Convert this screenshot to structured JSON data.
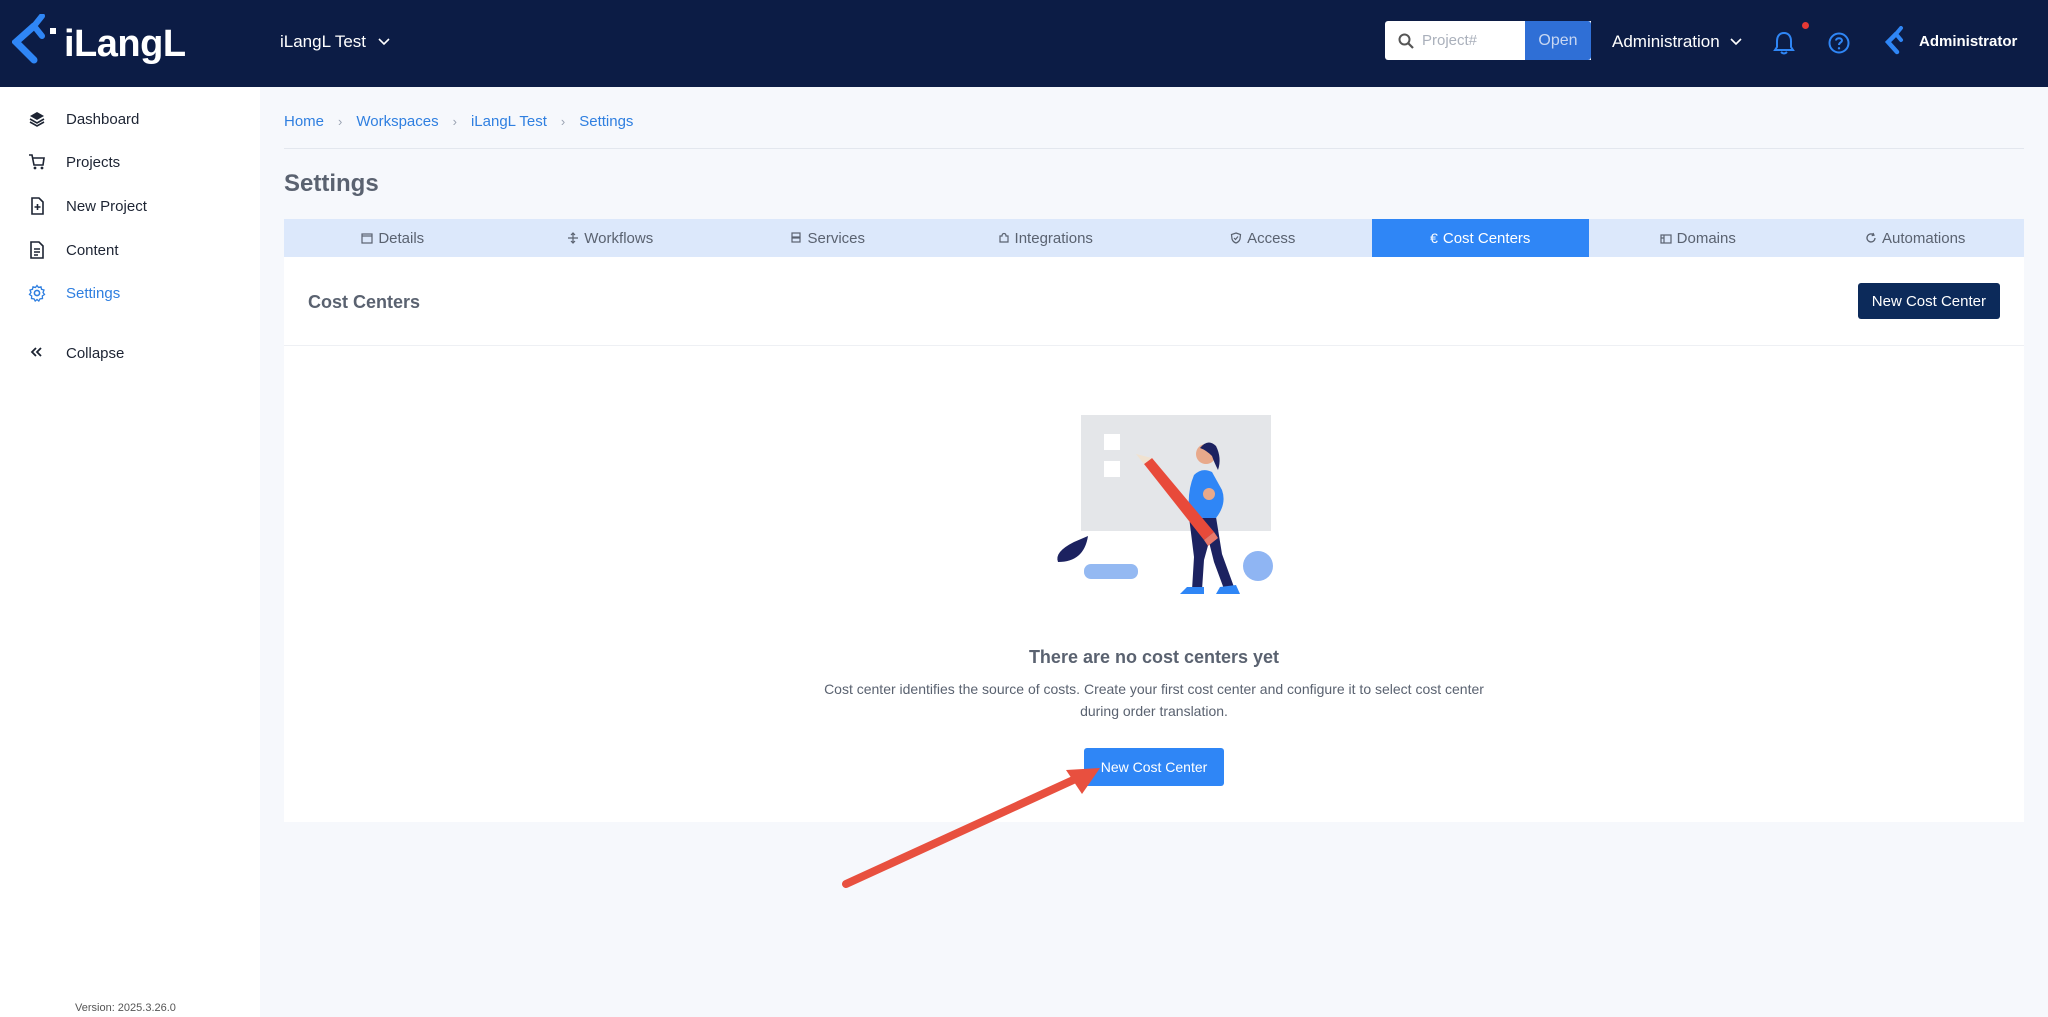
{
  "brand": {
    "logo_text": "iLangL"
  },
  "header": {
    "workspace": "iLangL Test",
    "search_placeholder": "Project#",
    "open_label": "Open",
    "admin_menu": "Administration",
    "user_name": "Administrator"
  },
  "sidebar": {
    "items": [
      {
        "label": "Dashboard",
        "icon": "layers-icon"
      },
      {
        "label": "Projects",
        "icon": "cart-icon"
      },
      {
        "label": "New Project",
        "icon": "file-plus-icon"
      },
      {
        "label": "Content",
        "icon": "documents-icon"
      },
      {
        "label": "Settings",
        "icon": "gear-icon",
        "active": true
      },
      {
        "label": "Collapse",
        "icon": "double-chevron-left-icon"
      }
    ],
    "version": "Version: 2025.3.26.0"
  },
  "breadcrumb": [
    "Home",
    "Workspaces",
    "iLangL Test",
    "Settings"
  ],
  "page_title": "Settings",
  "tabs": [
    {
      "label": "Details",
      "icon": "details-icon"
    },
    {
      "label": "Workflows",
      "icon": "workflow-icon"
    },
    {
      "label": "Services",
      "icon": "server-icon"
    },
    {
      "label": "Integrations",
      "icon": "puzzle-icon"
    },
    {
      "label": "Access",
      "icon": "shield-icon"
    },
    {
      "label": "Cost Centers",
      "icon": "euro-icon",
      "active": true
    },
    {
      "label": "Domains",
      "icon": "domains-icon"
    },
    {
      "label": "Automations",
      "icon": "refresh-icon"
    }
  ],
  "panel": {
    "title": "Cost Centers",
    "new_button": "New Cost Center",
    "empty_title": "There are no cost centers yet",
    "empty_desc": "Cost center identifies the source of costs. Create your first cost center and configure it to select cost center during order translation.",
    "empty_button": "New Cost Center"
  },
  "colors": {
    "header_bg": "#0c1c45",
    "accent": "#2f86f6",
    "tab_bar_bg": "#dce8fb",
    "primary_dark": "#0c2a5a",
    "annotation_arrow": "#e8503f"
  }
}
